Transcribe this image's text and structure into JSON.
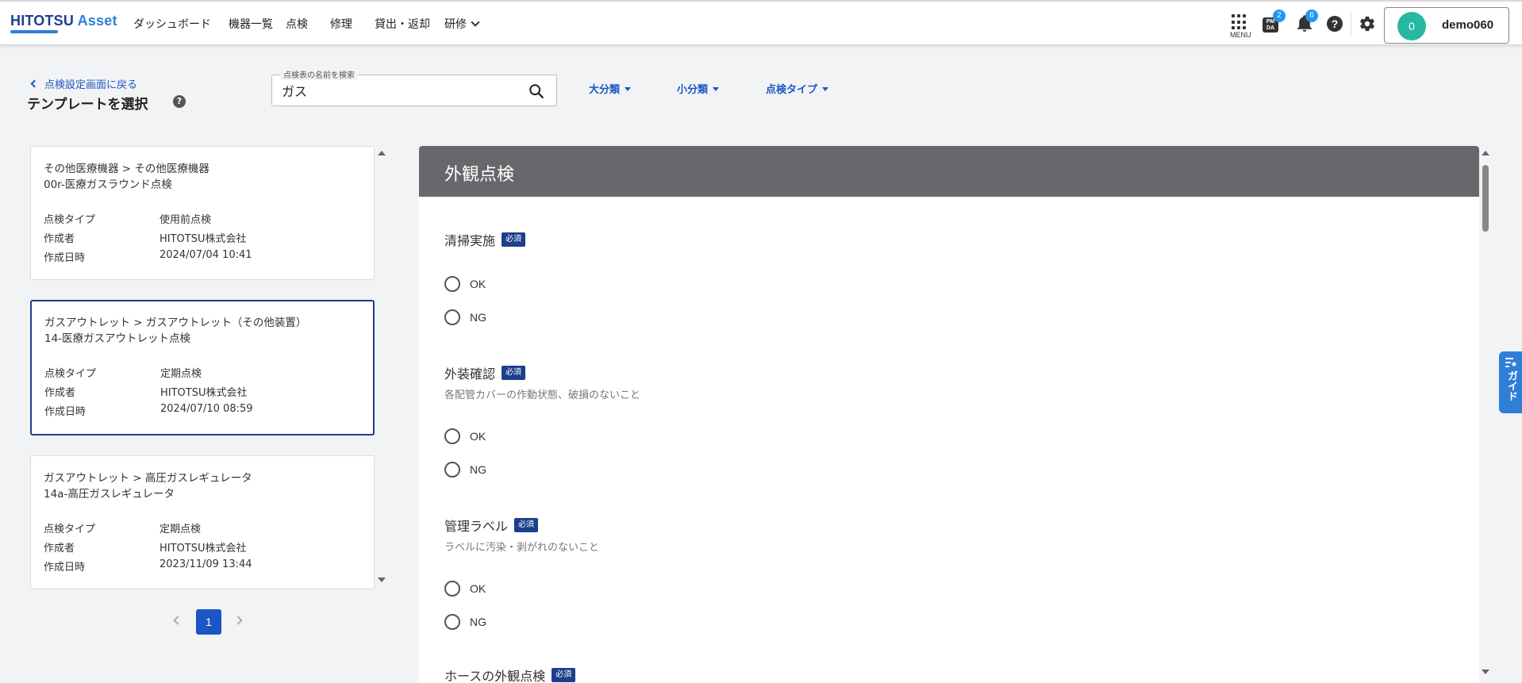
{
  "header": {
    "logo_main": "HITOTSU",
    "logo_accent": " Asset",
    "nav": [
      "ダッシュボード",
      "機器一覧",
      "点検",
      "修理",
      "貸出・返却",
      "研修"
    ],
    "menu_label": "MENU",
    "pmda_badge": "2",
    "pmda_label": "PM DA",
    "notification_badge": "6",
    "user_initial": "0",
    "user_name": "demo060"
  },
  "subheader": {
    "back_label": "点検設定画面に戻る",
    "title": "テンプレートを選択",
    "search_label": "点検表の名前を検索",
    "search_value": "ガス",
    "filters": [
      "大分類",
      "小分類",
      "点検タイプ"
    ]
  },
  "templates": [
    {
      "path": "その他医療機器 > その他医療機器",
      "name": "00r-医療ガスラウンド点検",
      "type_key": "点検タイプ",
      "type": "使用前点検",
      "author_key": "作成者",
      "author": "HITOTSU株式会社",
      "date_key": "作成日時",
      "date": "2024/07/04 10:41"
    },
    {
      "path": "ガスアウトレット > ガスアウトレット（その他装置）",
      "name": "14-医療ガスアウトレット点検",
      "type_key": "点検タイプ",
      "type": "定期点検",
      "author_key": "作成者",
      "author": "HITOTSU株式会社",
      "date_key": "作成日時",
      "date": "2024/07/10 08:59"
    },
    {
      "path": "ガスアウトレット > 高圧ガスレギュレータ",
      "name": "14a-高圧ガスレギュレータ",
      "type_key": "点検タイプ",
      "type": "定期点検",
      "author_key": "作成者",
      "author": "HITOTSU株式会社",
      "date_key": "作成日時",
      "date": "2023/11/09 13:44"
    }
  ],
  "pagination": {
    "current": "1"
  },
  "preview": {
    "section_title": "外観点検",
    "required_label": "必須",
    "questions": [
      {
        "label": "清掃実施",
        "desc": "",
        "options": [
          "OK",
          "NG"
        ]
      },
      {
        "label": "外装確認",
        "desc": "各配管カバーの作動状態、破損のないこと",
        "options": [
          "OK",
          "NG"
        ]
      },
      {
        "label": "管理ラベル",
        "desc": "ラベルに汚染・剥がれのないこと",
        "options": [
          "OK",
          "NG"
        ]
      },
      {
        "label": "ホースの外観点検",
        "desc": "",
        "options": []
      }
    ]
  },
  "guide_label": "ガイド",
  "colors": {
    "primary": "#1a56c4",
    "navy": "#1b3f8a",
    "header_gray": "#67686b",
    "avatar": "#26b8a0",
    "badge": "#2196f3"
  }
}
